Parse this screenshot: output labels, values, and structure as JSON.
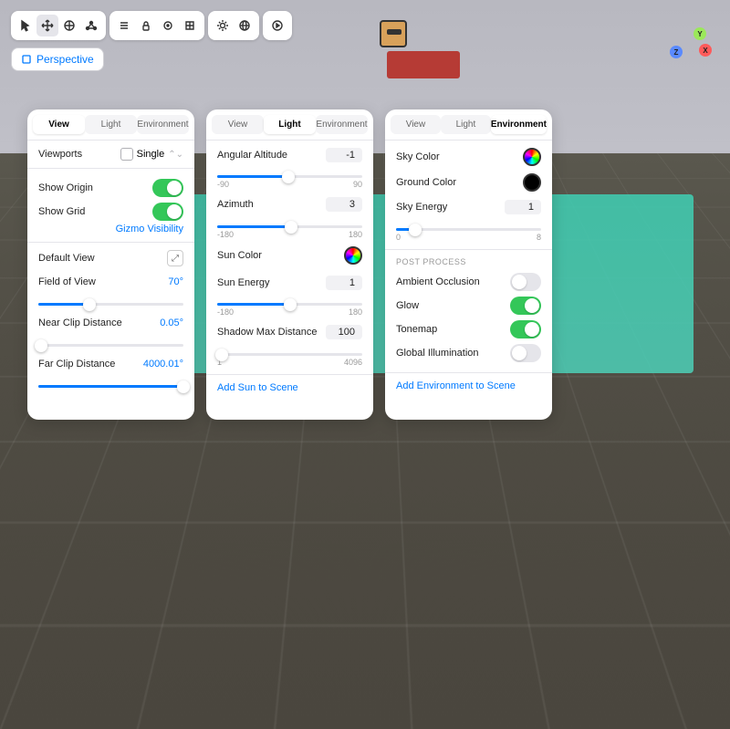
{
  "toolbar": {
    "perspective_label": "Perspective"
  },
  "tabs": {
    "view": "View",
    "light": "Light",
    "environment": "Environment"
  },
  "view_panel": {
    "viewports": "Viewports",
    "single": "Single",
    "show_origin": "Show Origin",
    "show_grid": "Show Grid",
    "gizmo_visibility": "Gizmo Visibility",
    "default_view": "Default View",
    "field_of_view": "Field of View",
    "fov_value": "70°",
    "near_clip": "Near Clip Distance",
    "near_clip_value": "0.05°",
    "far_clip": "Far Clip Distance",
    "far_clip_value": "4000.01°"
  },
  "light_panel": {
    "angular_altitude": "Angular Altitude",
    "angular_altitude_value": "-1",
    "angular_min": "-90",
    "angular_max": "90",
    "azimuth": "Azimuth",
    "azimuth_value": "3",
    "azimuth_min": "-180",
    "azimuth_max": "180",
    "sun_color": "Sun Color",
    "sun_energy": "Sun Energy",
    "sun_energy_value": "1",
    "sun_energy_min": "-180",
    "sun_energy_max": "180",
    "shadow_max": "Shadow Max Distance",
    "shadow_value": "100",
    "shadow_min": "1",
    "shadow_max_val": "4096",
    "add_sun": "Add Sun to Scene"
  },
  "env_panel": {
    "sky_color": "Sky Color",
    "ground_color": "Ground Color",
    "sky_energy": "Sky Energy",
    "sky_energy_value": "1",
    "sky_energy_min": "0",
    "sky_energy_max": "8",
    "post_process": "POST PROCESS",
    "ambient_occlusion": "Ambient Occlusion",
    "glow": "Glow",
    "tonemap": "Tonemap",
    "global_illumination": "Global Illumination",
    "add_env": "Add Environment to Scene"
  },
  "gizmo": {
    "x": "X",
    "y": "Y",
    "z": "Z"
  }
}
